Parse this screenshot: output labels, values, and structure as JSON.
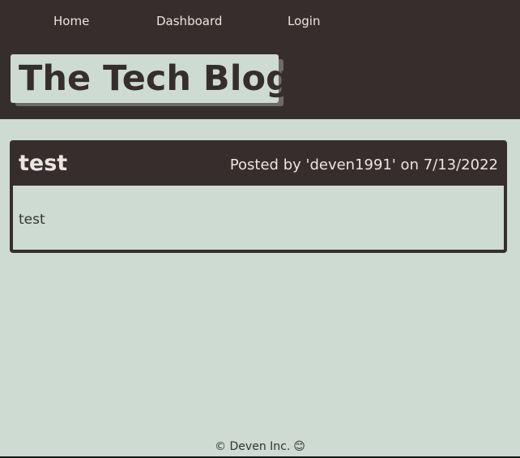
{
  "nav": {
    "home": "Home",
    "dashboard": "Dashboard",
    "login": "Login"
  },
  "header": {
    "title": "The Tech Blog"
  },
  "post": {
    "title": "test",
    "meta": "Posted by 'deven1991' on 7/13/2022",
    "body": "test"
  },
  "footer": {
    "text": "© Deven Inc.",
    "icon": "smiling-face-emoji",
    "icon_glyph": "😊"
  },
  "colors": {
    "page_background": "#cddbd2",
    "header_background": "#362e2d",
    "light_text": "#e8e6df",
    "dark_text": "#333333",
    "logo_shadow": "#6f6a68"
  }
}
